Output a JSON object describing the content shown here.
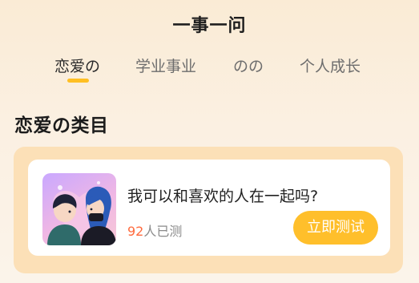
{
  "header": {
    "title": "一事一问"
  },
  "tabs": [
    {
      "label": "恋爱の",
      "active": true
    },
    {
      "label": "学业事业",
      "active": false
    },
    {
      "label": "のの",
      "active": false
    },
    {
      "label": "个人成长",
      "active": false
    }
  ],
  "section": {
    "title": "恋爱の类目"
  },
  "card": {
    "question": "我可以和喜欢的人在一起吗?",
    "tested_count": "92",
    "tested_suffix": "人已测",
    "button_label": "立即测试",
    "thumbnail_icon": "couple-illustration-icon"
  },
  "colors": {
    "accent": "#ffbf24",
    "count": "#ff6a3d",
    "card_frame": "#fce0b7"
  }
}
